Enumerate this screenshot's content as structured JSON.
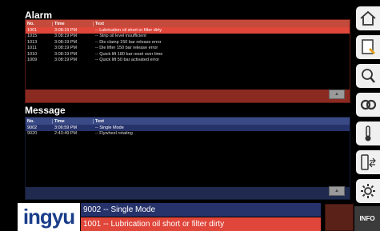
{
  "alarm": {
    "title": "Alarm",
    "columns": [
      "No.",
      "Time",
      "Text"
    ],
    "rows": [
      {
        "no": "1001",
        "time": "3:08:19 PM",
        "text": "-- Lubrication oil short or filter dirty",
        "selected": true
      },
      {
        "no": "1015",
        "time": "3:08:19 PM",
        "text": "-- Strip oil level insufficient",
        "selected": false
      },
      {
        "no": "1013",
        "time": "3:08:19 PM",
        "text": "-- Die clamp 150 bar release error",
        "selected": false
      },
      {
        "no": "1011",
        "time": "3:08:19 PM",
        "text": "-- Die lifter 150 bar release error",
        "selected": false
      },
      {
        "no": "1010",
        "time": "3:08:19 PM",
        "text": "-- Quick lift 180 bar reset over time",
        "selected": false
      },
      {
        "no": "1009",
        "time": "3:08:19 PM",
        "text": "-- Quick lift 50 bar activated error",
        "selected": false
      }
    ]
  },
  "message": {
    "title": "Message",
    "columns": [
      "No.",
      "Time",
      "Text"
    ],
    "rows": [
      {
        "no": "9002",
        "time": "3:06:59 PM",
        "text": "-- Single Mode",
        "selected": true
      },
      {
        "no": "9020",
        "time": "2:43:49 PM",
        "text": "-- Flywheel rotating",
        "selected": false
      }
    ]
  },
  "footer": {
    "logo": "ingyu",
    "status_message": "9002  -- Single Mode",
    "status_alarm": "1001  -- Lubrication oil short or filter dirty"
  },
  "sidebar": {
    "icons": [
      "home-icon",
      "note-icon",
      "search-icon",
      "gears-icon",
      "thermometer-icon",
      "device-transfer-icon",
      "settings-icon"
    ],
    "info_label": "INFO"
  },
  "colors": {
    "alarm_bg": "#8b2a20",
    "alarm_header": "#c44a3c",
    "alarm_selected": "#e0463a",
    "message_bg": "#1f2a4e",
    "message_header": "#3a4a86",
    "message_selected": "#26326a",
    "logo_blue": "#1a3d8a"
  }
}
